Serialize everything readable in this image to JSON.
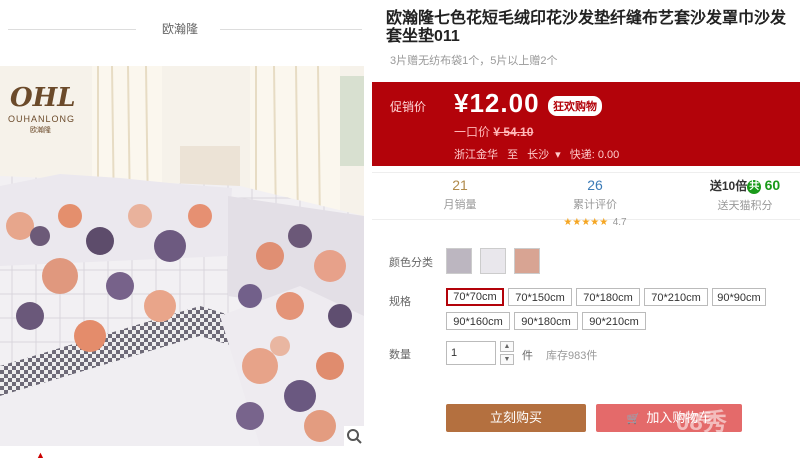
{
  "shop": {
    "name": "欧瀚隆"
  },
  "gallery": {
    "brand_logo": "OHL",
    "brand_en": "OUHANLONG",
    "brand_cn": "欧瀚隆",
    "zoom_icon": "magnifier-icon"
  },
  "product": {
    "title": "欧瀚隆七色花短毛绒印花沙发垫纤缝布艺套沙发罩巾沙发套坐垫011",
    "promo": "3片赠无纺布袋1个，5片以上赠2个"
  },
  "price": {
    "label": "促销价",
    "value": "¥12.00",
    "badge": "狂欢购物",
    "orig_label": "一口价",
    "orig_value": "¥ 54.10",
    "ship_from": "浙江金华",
    "ship_to_label": "至",
    "ship_to": "长沙",
    "shipping": "快递: 0.00"
  },
  "stats": {
    "monthly_sales": "21",
    "monthly_sales_label": "月销量",
    "reviews": "26",
    "reviews_label": "累计评价",
    "rating": "4.7",
    "points_prefix": "送10倍",
    "points_icon": "共",
    "points_value": "60",
    "points_label": "送天猫积分"
  },
  "options": {
    "color_label": "颜色分类",
    "size_label": "规格",
    "sizes": [
      "70*70cm",
      "70*150cm",
      "70*180cm",
      "70*210cm",
      "90*90cm",
      "90*160cm",
      "90*180cm",
      "90*210cm"
    ],
    "selected_size": "70*70cm",
    "qty_label": "数量",
    "qty_value": "1",
    "qty_unit": "件",
    "stock": "库存983件"
  },
  "actions": {
    "buy": "立刻购买",
    "cart": "加入购物车",
    "watermark": "08秀"
  },
  "colors": {
    "accent": "#b3030a",
    "buy": "#b4703f",
    "cart": "#e46a6a"
  }
}
